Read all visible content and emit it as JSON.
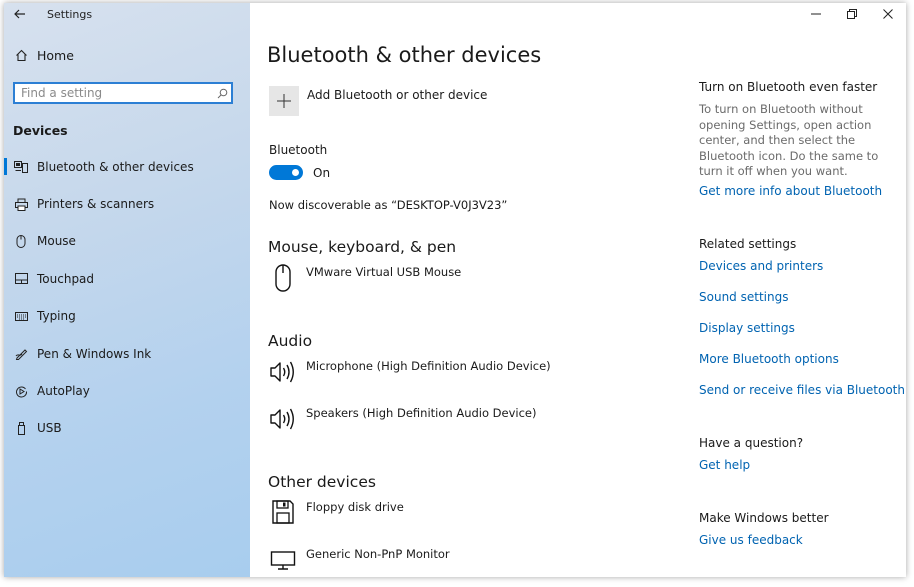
{
  "app": {
    "title": "Settings"
  },
  "sidebar": {
    "home_label": "Home",
    "search_placeholder": "Find a setting",
    "section_title": "Devices",
    "items": [
      {
        "label": "Bluetooth & other devices",
        "icon": "bluetooth-devices-icon",
        "selected": true
      },
      {
        "label": "Printers & scanners",
        "icon": "printer-icon",
        "selected": false
      },
      {
        "label": "Mouse",
        "icon": "mouse-icon",
        "selected": false
      },
      {
        "label": "Touchpad",
        "icon": "touchpad-icon",
        "selected": false
      },
      {
        "label": "Typing",
        "icon": "keyboard-icon",
        "selected": false
      },
      {
        "label": "Pen & Windows Ink",
        "icon": "pen-icon",
        "selected": false
      },
      {
        "label": "AutoPlay",
        "icon": "autoplay-icon",
        "selected": false
      },
      {
        "label": "USB",
        "icon": "usb-icon",
        "selected": false
      }
    ]
  },
  "main": {
    "page_title": "Bluetooth & other devices",
    "add_device_label": "Add Bluetooth or other device",
    "bluetooth_label": "Bluetooth",
    "bluetooth_state": "On",
    "discoverable_text": "Now discoverable as “DESKTOP-V0J3V23”",
    "groups": [
      {
        "title": "Mouse, keyboard, & pen",
        "devices": [
          {
            "name": "VMware Virtual USB Mouse",
            "icon": "mouse-icon"
          }
        ]
      },
      {
        "title": "Audio",
        "devices": [
          {
            "name": "Microphone (High Definition Audio Device)",
            "icon": "speaker-icon"
          },
          {
            "name": "Speakers (High Definition Audio Device)",
            "icon": "speaker-icon"
          }
        ]
      },
      {
        "title": "Other devices",
        "devices": [
          {
            "name": "Floppy disk drive",
            "icon": "floppy-disk-icon"
          },
          {
            "name": "Generic Non-PnP Monitor",
            "icon": "monitor-icon"
          }
        ]
      }
    ]
  },
  "right": {
    "faster_title": "Turn on Bluetooth even faster",
    "faster_desc": "To turn on Bluetooth without opening Settings, open action center, and then select the Bluetooth icon. Do the same to turn it off when you want.",
    "faster_link": "Get more info about Bluetooth",
    "related_title": "Related settings",
    "related_links": [
      "Devices and printers",
      "Sound settings",
      "Display settings",
      "More Bluetooth options",
      "Send or receive files via Bluetooth"
    ],
    "question_title": "Have a question?",
    "question_link": "Get help",
    "better_title": "Make Windows better",
    "better_link": "Give us feedback"
  },
  "colors": {
    "accent": "#0078d7",
    "link": "#0063b1",
    "search_border": "#2c7fd4"
  }
}
